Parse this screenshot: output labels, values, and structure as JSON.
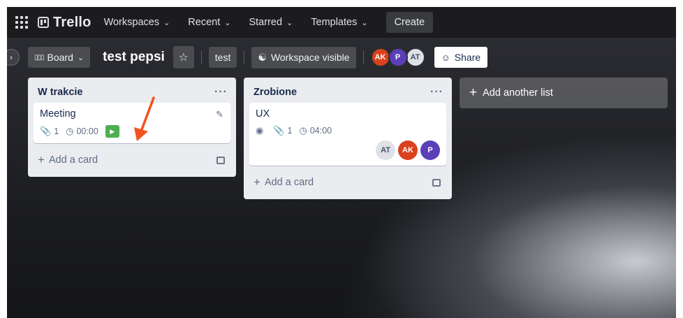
{
  "nav": {
    "logo": "Trello",
    "items": [
      {
        "label": "Workspaces"
      },
      {
        "label": "Recent"
      },
      {
        "label": "Starred"
      },
      {
        "label": "Templates"
      }
    ],
    "create_label": "Create"
  },
  "board": {
    "view_label": "Board",
    "title": "test pepsi",
    "workspace_label": "test",
    "visibility_label": "Workspace visible",
    "members": [
      "AK",
      "P",
      "AT"
    ],
    "share_label": "Share"
  },
  "lists": [
    {
      "title": "W trakcie",
      "cards": [
        {
          "title": "Meeting",
          "attachments": "1",
          "timer": "00:00"
        }
      ],
      "add_card_label": "Add a card"
    },
    {
      "title": "Zrobione",
      "cards": [
        {
          "title": "UX",
          "attachments": "1",
          "timer": "04:00",
          "members": [
            "AT",
            "AK",
            "P"
          ]
        }
      ],
      "add_card_label": "Add a card"
    }
  ],
  "add_list_label": "Add another list",
  "colors": {
    "accent_green": "#4caf50",
    "annotation_arrow": "#f4511e",
    "avatar_ak": "#d9421d",
    "avatar_p": "#5a3fb8",
    "avatar_at": "#dfe1e6"
  }
}
